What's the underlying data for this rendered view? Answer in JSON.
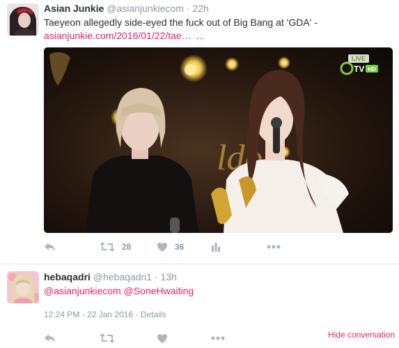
{
  "tweet1": {
    "fullname": "Asian Junkie",
    "username": "@asianjunkiecom",
    "time": "22h",
    "text": "Taeyeon allegedly side-eyed the fuck out of Big Bang at 'GDA' -",
    "link": "asianjunkie.com/2016/01/22/tae…",
    "ellipsis": "...",
    "media": {
      "stage_sign": "ldo",
      "watermark": "TV",
      "live_badge": "LIVE",
      "hd_badge": "HD"
    },
    "actions": {
      "reply_icon": "reply-icon",
      "retweet_icon": "retweet-icon",
      "retweet_count": "28",
      "like_icon": "heart-icon",
      "like_count": "36",
      "analytics_icon": "analytics-icon",
      "more_icon": "more-icon"
    }
  },
  "tweet2": {
    "fullname": "hebaqadri",
    "username": "@hebaqadri1",
    "time": "13h",
    "mention1": "@asianjunkiecom",
    "mention2": "@SoneHwaiting",
    "timestamp": "12:24 PM - 22 Jan 2016",
    "details": "Details",
    "hide_conversation": "Hide conversation"
  },
  "colors": {
    "link": "#e0245e",
    "muted": "#8899a6",
    "icon": "#aab8c2",
    "text": "#292f33"
  }
}
